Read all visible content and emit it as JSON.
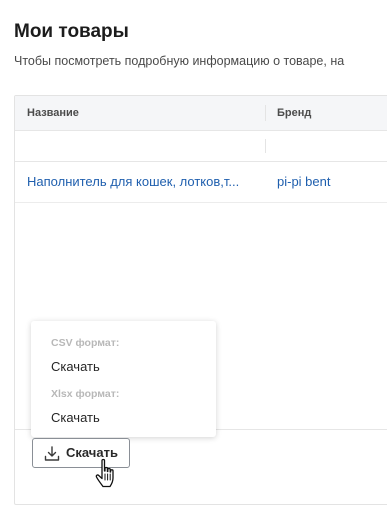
{
  "header": {
    "title": "Мои товары",
    "subtitle": "Чтобы посмотреть подробную информацию о товаре, на"
  },
  "table": {
    "columns": [
      {
        "label": "Название"
      },
      {
        "label": "Бренд"
      }
    ],
    "rows": [
      {
        "name": "Наполнитель для кошек, лотков,т...",
        "brand": "pi-pi bent"
      }
    ]
  },
  "download_menu": {
    "groups": [
      {
        "label": "CSV формат:",
        "item": "Скачать"
      },
      {
        "label": "Xlsx формат:",
        "item": "Скачать"
      }
    ]
  },
  "download_button": {
    "label": "Скачать",
    "icon": "download-icon"
  },
  "cursor": {
    "icon": "hand-pointer-icon"
  }
}
